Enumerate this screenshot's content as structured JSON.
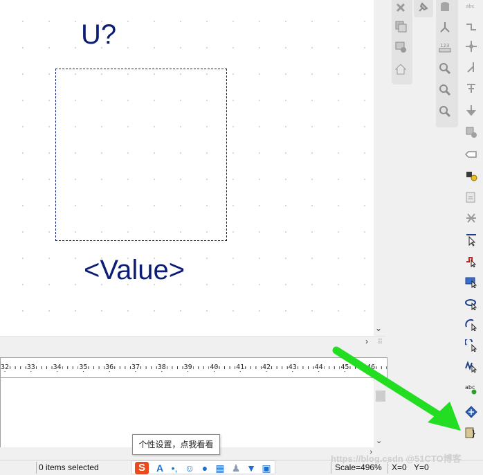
{
  "schematic": {
    "designator": "U?",
    "value": "<Value>"
  },
  "ruler": {
    "labels": [
      "32",
      "33",
      "34",
      "35",
      "36",
      "37",
      "38",
      "39",
      "40",
      "41",
      "42",
      "43",
      "44",
      "45",
      "46"
    ]
  },
  "tooltip": {
    "text": "个性设置，点我看看"
  },
  "status": {
    "selection": "0 items selected",
    "scale": "Scale=496%",
    "x": "X=0",
    "y": "Y=0"
  },
  "watermark": "https://blog.csdn @51CTO博客",
  "icons": {
    "strip1": [
      "close-icon",
      "copy-window-icon",
      "settings-window-icon",
      "home-icon"
    ],
    "strip2": [
      "pin-icon"
    ],
    "strip3": [
      "db-icon",
      "arrows-icon",
      "ruler-icon",
      "zoom-in-icon",
      "zoom-out-icon",
      "zoom-fit-icon"
    ],
    "main": [
      "text-abc-icon",
      "wire-icon",
      "junction-icon",
      "bus-entry-icon",
      "power-icon",
      "ground-icon",
      "component-add-icon",
      "net-label-icon",
      "pin-add-icon",
      "sheet-icon",
      "no-connect-icon",
      "select-arrow-icon",
      "polyline-icon",
      "rectangle-icon",
      "circle-icon",
      "arc-icon",
      "bezier-icon",
      "wave-icon",
      "text-add-icon",
      "anchor-icon",
      "code-icon"
    ]
  },
  "colors": {
    "schematic_blue": "#0b1d75",
    "arrow_green": "#22dd22",
    "ime_orange": "#ea4b1d"
  }
}
